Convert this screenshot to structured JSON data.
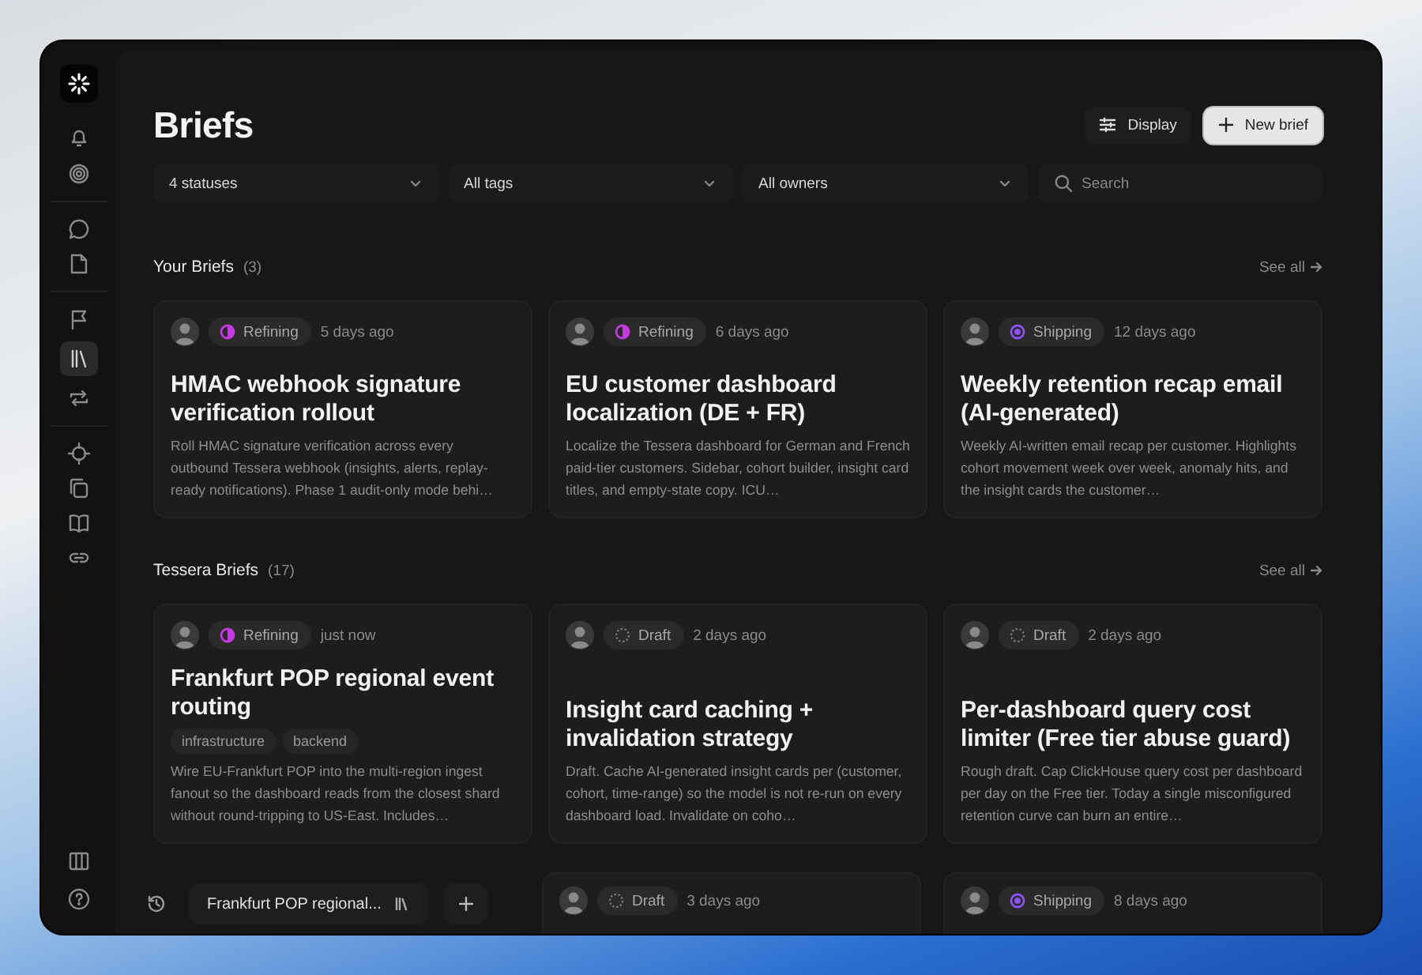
{
  "sidebar": {
    "items": [
      {
        "selected": false
      },
      {
        "selected": false
      },
      {
        "selected": false
      },
      {
        "selected": false
      },
      {
        "selected": false
      },
      {
        "selected": true
      },
      {
        "selected": false
      },
      {
        "selected": false
      },
      {
        "selected": false
      },
      {
        "selected": false
      },
      {
        "selected": false
      }
    ],
    "bottom_items": [
      {
        "selected": false
      },
      {
        "selected": false
      }
    ]
  },
  "header": {
    "title": "Briefs",
    "buttons": [
      {
        "label": "Display",
        "kind": "secondary"
      },
      {
        "label": "New brief",
        "kind": "primary"
      }
    ]
  },
  "filters": [
    {
      "label": "4 statuses"
    },
    {
      "label": "All tags"
    },
    {
      "label": "All owners"
    }
  ],
  "search": {
    "placeholder": "Search"
  },
  "sections": [
    {
      "title": "Your Briefs",
      "count": "(3)",
      "link": "See all",
      "cards": [
        {
          "status": {
            "kind": "refining",
            "label": "Refining"
          },
          "time": "5 days ago",
          "title": "HMAC webhook signature verification rollout",
          "description": "Roll HMAC signature verification across every outbound Tessera webhook (insights, alerts, replay-ready notifications). Phase 1 audit-only mode behi…"
        },
        {
          "status": {
            "kind": "refining",
            "label": "Refining"
          },
          "time": "6 days ago",
          "title": "EU customer dashboard localization (DE + FR)",
          "description": "Localize the Tessera dashboard for German and French paid-tier customers. Sidebar, cohort builder, insight card titles, and empty-state copy. ICU…"
        },
        {
          "status": {
            "kind": "shipping",
            "label": "Shipping"
          },
          "time": "12 days ago",
          "title": "Weekly retention recap email (AI-generated)",
          "description": "Weekly AI-written email recap per customer. Highlights cohort movement week over week, anomaly hits, and the insight cards the customer…"
        }
      ]
    },
    {
      "title": "Tessera Briefs",
      "count": "(17)",
      "link": "See all",
      "cards": [
        {
          "status": {
            "kind": "refining",
            "label": "Refining"
          },
          "time": "just now",
          "title": "Frankfurt POP regional event routing",
          "tags": [
            "infrastructure",
            "backend"
          ],
          "description": "Wire EU-Frankfurt POP into the multi-region ingest fanout so the dashboard reads from the closest shard without round-tripping to US-East. Includes…"
        },
        {
          "status": {
            "kind": "draft",
            "label": "Draft"
          },
          "time": "2 days ago",
          "title": "Insight card caching + invalidation strategy",
          "description": "Draft. Cache AI-generated insight cards per (customer, cohort, time-range) so the model is not re-run on every dashboard load. Invalidate on coho…"
        },
        {
          "status": {
            "kind": "draft",
            "label": "Draft"
          },
          "time": "2 days ago",
          "title": "Per-dashboard query cost limiter (Free tier abuse guard)",
          "description": "Rough draft. Cap ClickHouse query cost per dashboard per day on the Free tier. Today a single misconfigured retention curve can burn an entire…"
        }
      ],
      "peek_cards": [
        {
          "status": {
            "kind": "draft",
            "label": "Draft"
          },
          "time": "3 days ago"
        },
        {
          "status": {
            "kind": "shipping",
            "label": "Shipping"
          },
          "time": "8 days ago"
        }
      ]
    }
  ],
  "bottom_bar": {
    "tab": {
      "label": "Frankfurt POP regional...",
      "selected": true
    }
  }
}
